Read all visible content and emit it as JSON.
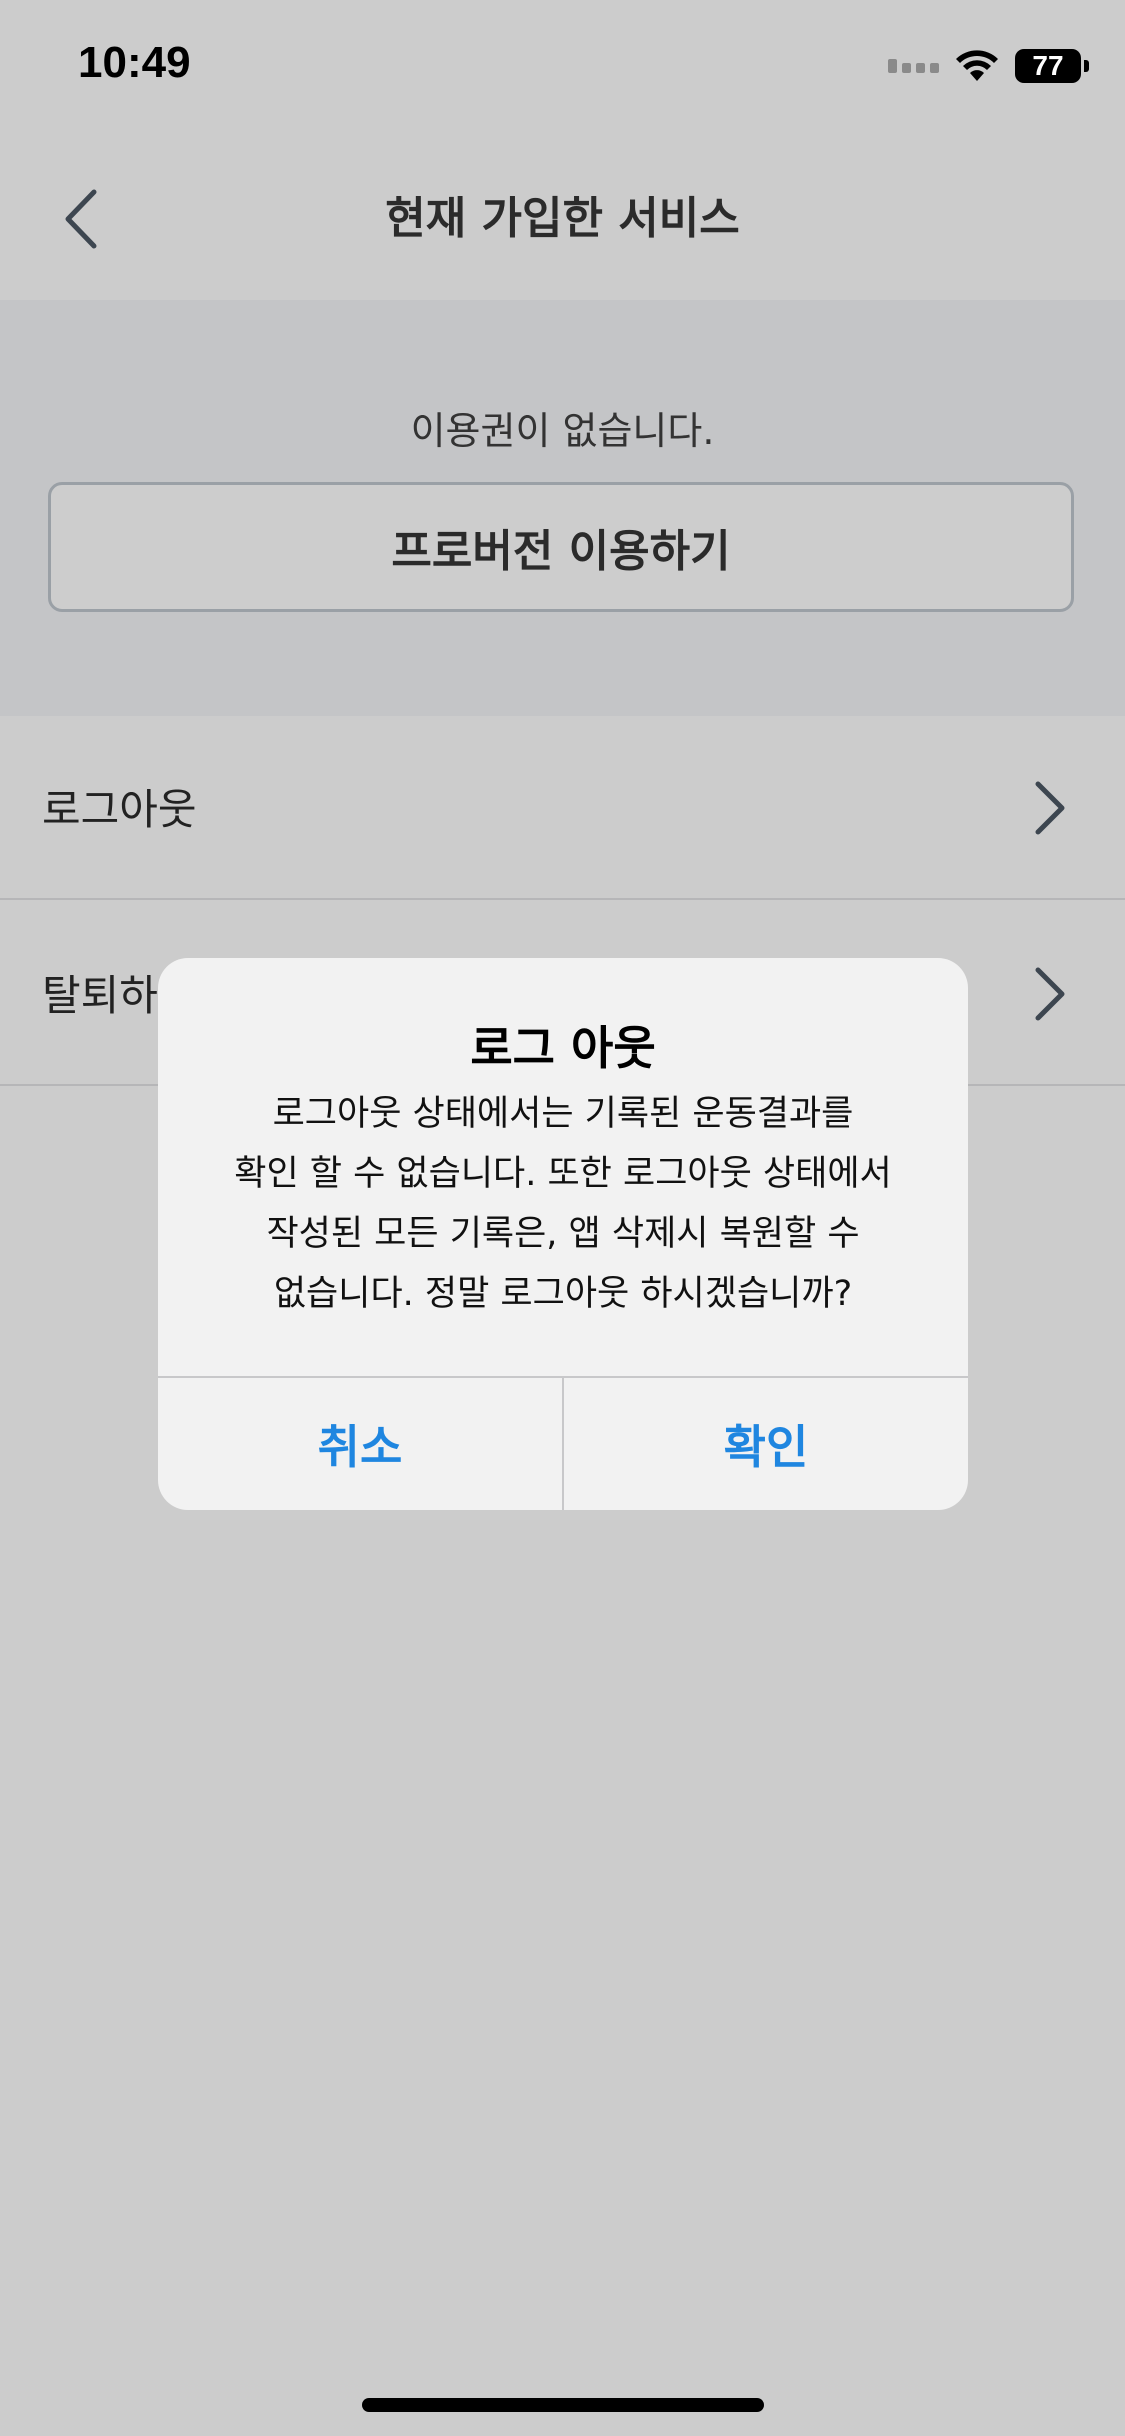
{
  "status_bar": {
    "time": "10:49",
    "battery": "77"
  },
  "nav": {
    "title": "현재 가입한 서비스"
  },
  "subscription": {
    "message": "이용권이 없습니다.",
    "pro_button_label": "프로버전 이용하기"
  },
  "list": {
    "items": [
      {
        "label": "로그아웃"
      },
      {
        "label": "탈퇴하기"
      }
    ]
  },
  "dialog": {
    "title": "로그 아웃",
    "message_lines": [
      "로그아웃 상태에서는 기록된 운동결과를",
      "확인 할 수 없습니다. 또한 로그아웃 상태에서",
      "작성된 모든 기록은, 앱 삭제시 복원할 수",
      "없습니다. 정말 로그아웃 하시겠습니까?"
    ],
    "cancel_label": "취소",
    "confirm_label": "확인"
  },
  "colors": {
    "background": "#cccccc",
    "panel": "#c4c5c7",
    "dialog_bg": "#f2f2f2",
    "accent": "#1f86e0"
  }
}
